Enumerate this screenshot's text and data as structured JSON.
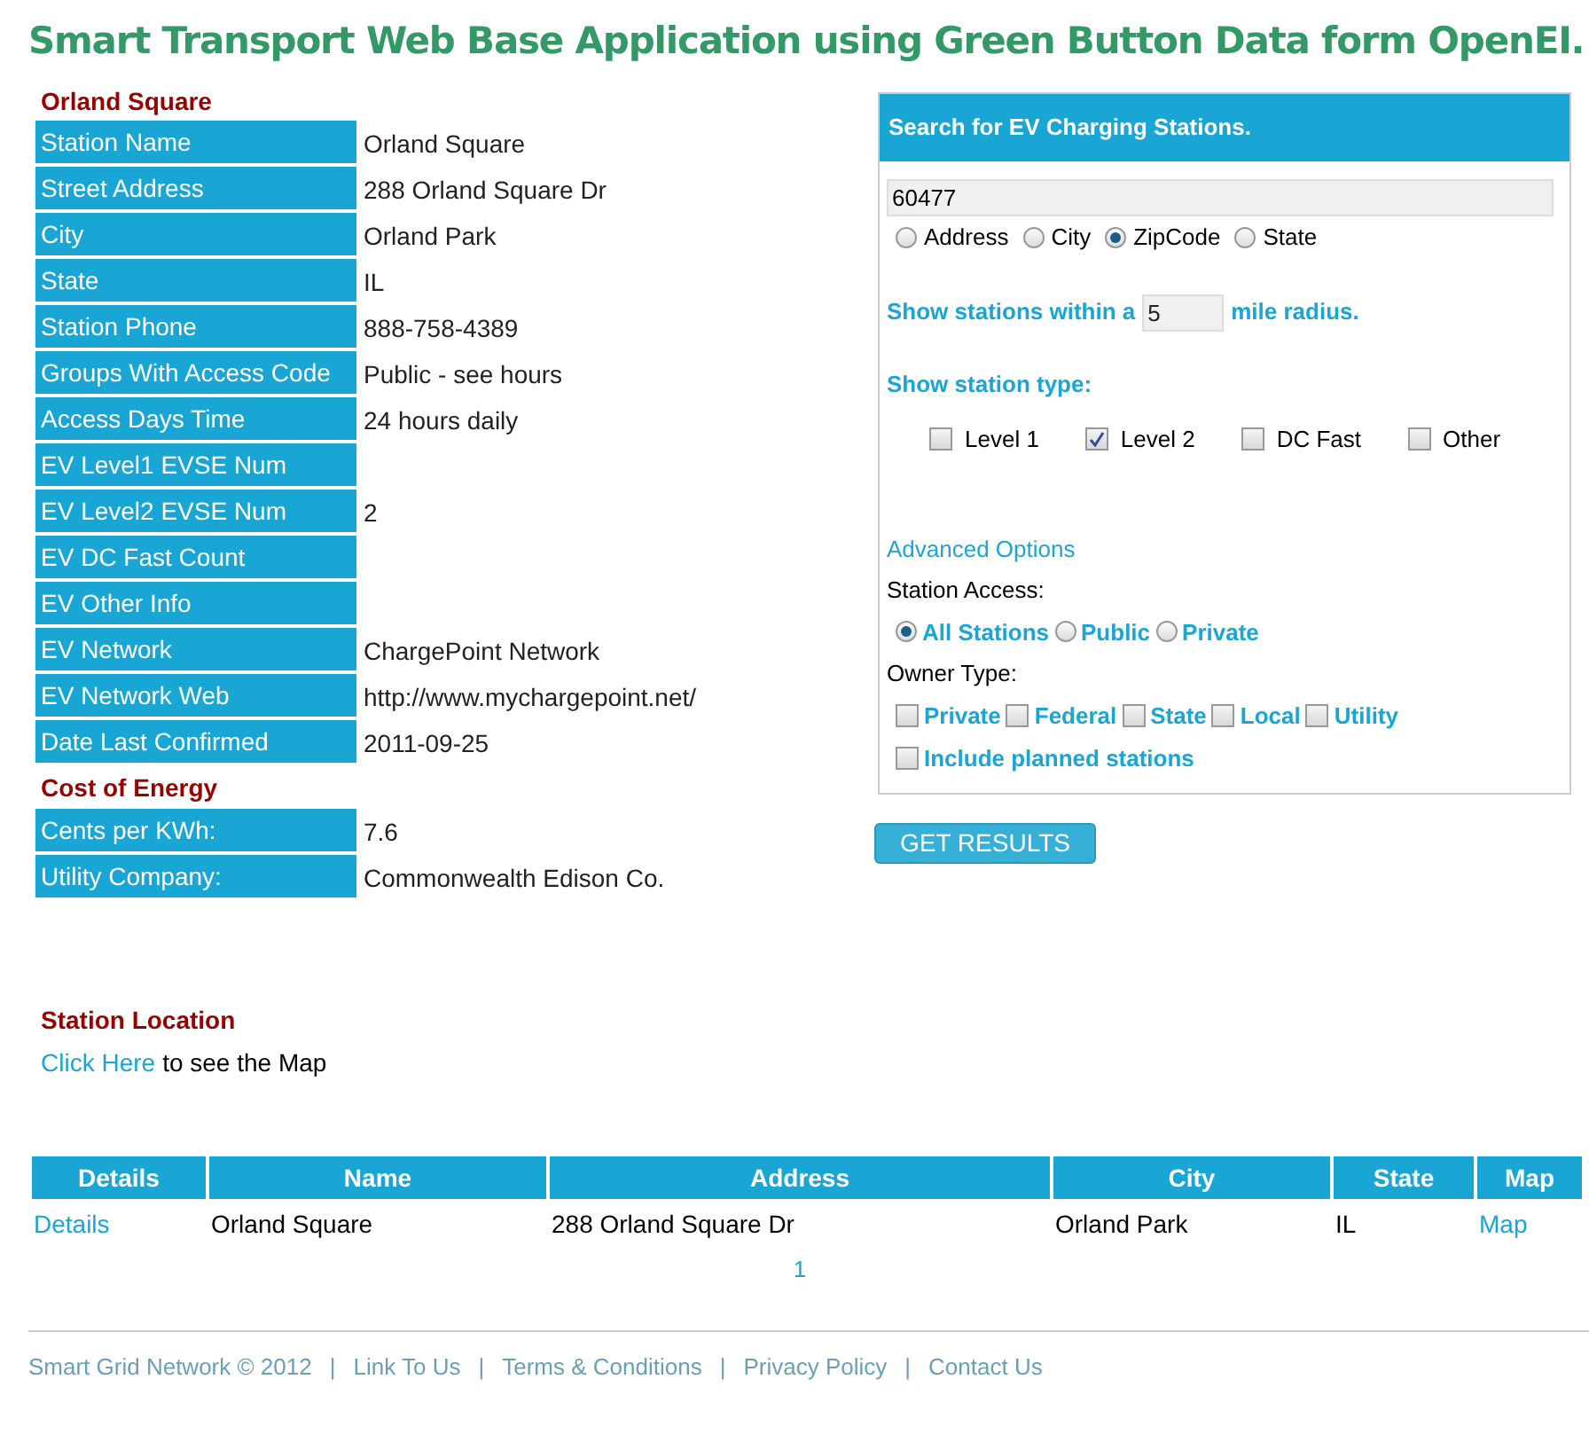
{
  "title": "Smart Transport Web Base Application using Green Button Data form OpenEI.",
  "station": {
    "heading": "Orland Square",
    "rows": [
      {
        "label": "Station Name",
        "value": "Orland Square"
      },
      {
        "label": "Street Address",
        "value": "288 Orland Square Dr"
      },
      {
        "label": "City",
        "value": "Orland Park"
      },
      {
        "label": "State",
        "value": "IL"
      },
      {
        "label": "Station Phone",
        "value": "888-758-4389"
      },
      {
        "label": "Groups With Access Code",
        "value": "Public - see hours"
      },
      {
        "label": "Access Days Time",
        "value": "24 hours daily"
      },
      {
        "label": "EV Level1 EVSE Num"
      },
      {
        "label": "EV Level2 EVSE Num",
        "value": "2"
      },
      {
        "label": "EV DC Fast Count"
      },
      {
        "label": "EV Other Info"
      },
      {
        "label": "EV Network",
        "value": "ChargePoint Network"
      },
      {
        "label": "EV Network Web",
        "value": "http://www.mychargepoint.net/"
      },
      {
        "label": "Date Last Confirmed",
        "value": "2011-09-25"
      }
    ]
  },
  "energy": {
    "heading": "Cost of Energy",
    "rows": [
      {
        "label": "Cents per KWh:",
        "value": "7.6"
      },
      {
        "label": "Utility Company:",
        "value": "Commonwealth Edison Co."
      }
    ]
  },
  "location": {
    "heading": "Station Location",
    "link": "Click Here",
    "text": "to see the Map"
  },
  "search": {
    "title": "Search for EV Charging Stations.",
    "value": "60477",
    "search_by": [
      {
        "label": "Address",
        "selected": false
      },
      {
        "label": "City",
        "selected": false
      },
      {
        "label": "ZipCode",
        "selected": true
      },
      {
        "label": "State",
        "selected": false
      }
    ],
    "radius_before": "Show stations within a",
    "radius": "5",
    "radius_after": "mile radius.",
    "type_label": "Show station type:",
    "types": [
      {
        "label": "Level 1",
        "checked": false
      },
      {
        "label": "Level 2",
        "checked": true
      },
      {
        "label": "DC Fast",
        "checked": false
      },
      {
        "label": "Other",
        "checked": false
      }
    ],
    "advanced": "Advanced Options",
    "access_label": "Station Access:",
    "access": [
      {
        "label": "All Stations",
        "selected": true
      },
      {
        "label": "Public",
        "selected": false
      },
      {
        "label": "Private",
        "selected": false
      }
    ],
    "owner_label": "Owner Type:",
    "owners": [
      {
        "label": "Private",
        "checked": false
      },
      {
        "label": "Federal",
        "checked": false
      },
      {
        "label": "State",
        "checked": false
      },
      {
        "label": "Local",
        "checked": false
      },
      {
        "label": "Utility",
        "checked": false
      }
    ],
    "planned": {
      "label": "Include planned stations",
      "checked": false
    },
    "button": "GET RESULTS"
  },
  "table": {
    "columns": [
      "Details",
      "Name",
      "Address",
      "City",
      "State",
      "Map"
    ],
    "rows": [
      {
        "details": "Details",
        "name": "Orland Square",
        "address": "288 Orland Square Dr",
        "city": "Orland Park",
        "state": "IL",
        "map": "Map"
      }
    ],
    "pages": [
      "1"
    ]
  },
  "footer": {
    "copyright": "Smart Grid Network © 2012",
    "separator": "|",
    "links": [
      "Link To Us",
      "Terms & Conditions",
      "Privacy Policy",
      "Contact Us"
    ]
  }
}
